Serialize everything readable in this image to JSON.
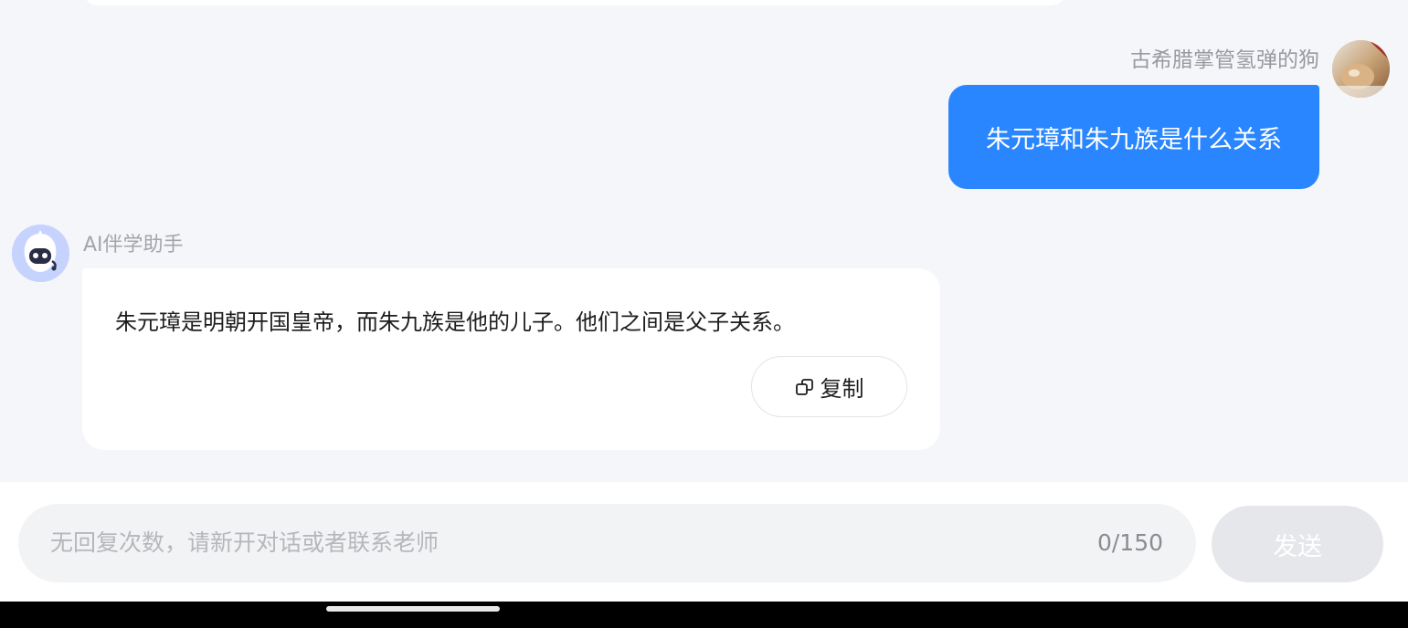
{
  "chat": {
    "user": {
      "name": "古希腊掌管氢弹的狗",
      "message": "朱元璋和朱九族是什么关系"
    },
    "assistant": {
      "name": "AI伴学助手",
      "message": "朱元璋是明朝开国皇帝，而朱九族是他的儿子。他们之间是父子关系。",
      "copy_label": "复制",
      "copy_icon": "copy-icon"
    }
  },
  "composer": {
    "placeholder": "无回复次数，请新开对话或者联系老师",
    "counter": "0/150",
    "send_label": "发送"
  },
  "colors": {
    "accent": "#2a86ff",
    "background": "#f5f6fa",
    "send_disabled": "#e6e7ea"
  }
}
